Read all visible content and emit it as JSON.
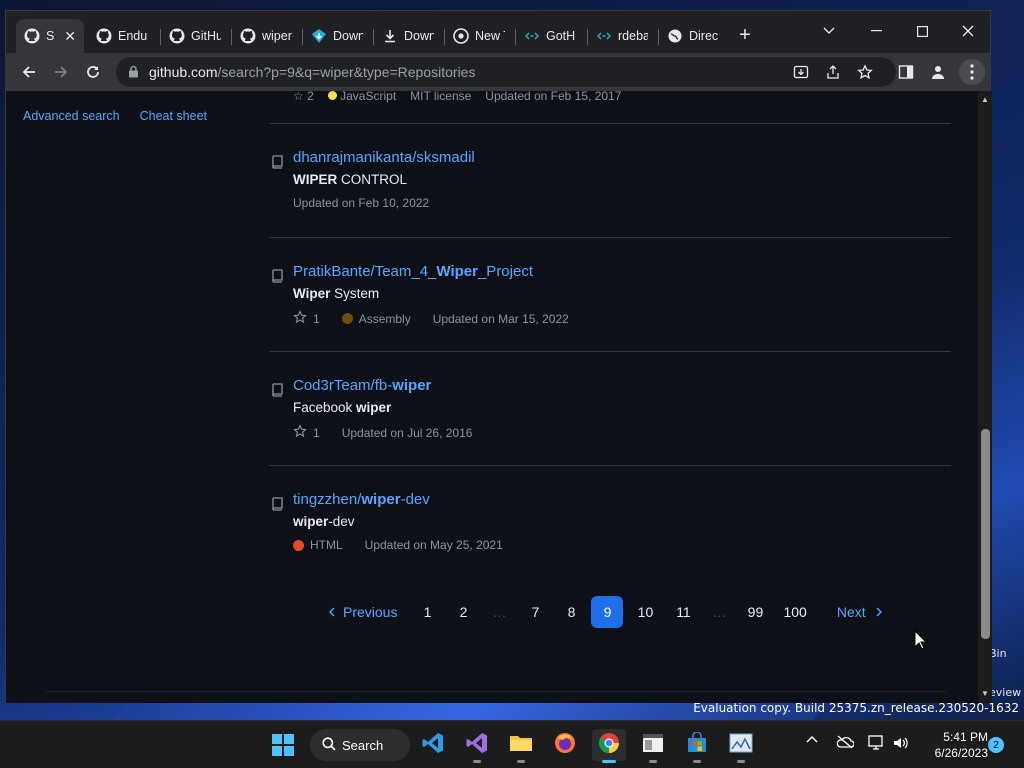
{
  "desktop": {
    "recycle_bin_label": "Bin",
    "preview_label": "eview",
    "eval_text": "Evaluation copy. Build 25375.zn_release.230520-1632"
  },
  "browser": {
    "tabs": [
      {
        "title": "Se",
        "icon": "github-icon",
        "active": true
      },
      {
        "title": "Endur",
        "icon": "github-icon"
      },
      {
        "title": "GitHu",
        "icon": "github-icon"
      },
      {
        "title": "wiper",
        "icon": "github-icon"
      },
      {
        "title": "Down",
        "icon": "diamond-download-icon"
      },
      {
        "title": "Down",
        "icon": "download-icon"
      },
      {
        "title": "New T",
        "icon": "chrome-icon"
      },
      {
        "title": "GotH",
        "icon": "link-icon"
      },
      {
        "title": "rdeba",
        "icon": "link-icon"
      },
      {
        "title": "Direc",
        "icon": "globe-icon"
      }
    ],
    "url_host": "github.com",
    "url_path": "/search?p=9&q=wiper&type=Repositories"
  },
  "sidebar": {
    "advanced_search": "Advanced search",
    "cheat_sheet": "Cheat sheet"
  },
  "cut_row": {
    "stars": "2",
    "language": "JavaScript",
    "license": "MIT license",
    "updated": "Updated on Feb 15, 2017"
  },
  "results": [
    {
      "owner": "dhanrajmanikanta/",
      "name_plain": "sksmadil",
      "desc_bold": "WIPER",
      "desc_rest": " CONTROL",
      "updated": "Updated on Feb 10, 2022"
    },
    {
      "owner": "PratikBante/Team_4_",
      "name_bold": "Wiper",
      "name_after": "_Project",
      "desc_bold": "Wiper",
      "desc_rest": " System",
      "stars": "1",
      "language": "Assembly",
      "language_color": "#6e4c13",
      "updated": "Updated on Mar 15, 2022"
    },
    {
      "owner": "Cod3rTeam/fb-",
      "name_bold": "wiper",
      "desc_plain": "Facebook ",
      "desc_bold": "wiper",
      "stars": "1",
      "updated": "Updated on Jul 26, 2016"
    },
    {
      "owner": "tingzzhen/",
      "name_bold": "wiper",
      "name_after": "-dev",
      "desc_bold": "wiper",
      "desc_rest": "-dev",
      "language": "HTML",
      "language_color": "#e34c26",
      "updated": "Updated on May 25, 2021"
    }
  ],
  "pagination": {
    "previous": "Previous",
    "pages": [
      "1",
      "2",
      "…",
      "7",
      "8",
      "9",
      "10",
      "11",
      "…",
      "99",
      "100"
    ],
    "current": "9",
    "next": "Next"
  },
  "taskbar": {
    "search_label": "Search",
    "time": "5:41 PM",
    "date": "6/26/2023",
    "notifications": "2"
  }
}
